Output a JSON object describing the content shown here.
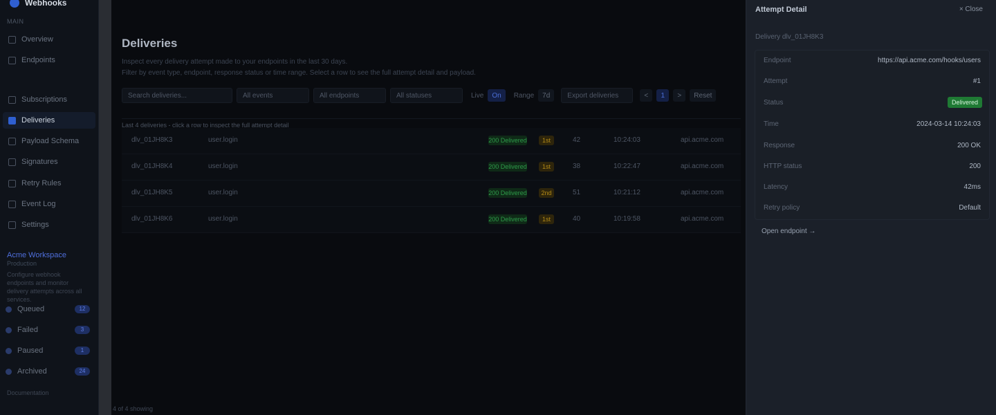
{
  "sidebar": {
    "brand": "Webhooks",
    "section_main": "Main",
    "nav": [
      "Overview",
      "Endpoints",
      "Subscriptions",
      "Deliveries",
      "Payload Schema",
      "Signatures",
      "Retry Rules",
      "Event Log",
      "Settings"
    ],
    "active_index": 3,
    "workspace_title": "Acme Workspace",
    "workspace_sub": "Production",
    "workspace_desc": "Configure webhook endpoints and monitor delivery attempts across all services.",
    "workspace_items": [
      {
        "label": "Queued",
        "count": "12"
      },
      {
        "label": "Failed",
        "count": "3"
      },
      {
        "label": "Paused",
        "count": "1"
      },
      {
        "label": "Archived",
        "count": "24"
      }
    ],
    "footer_label": "Documentation"
  },
  "main": {
    "title": "Deliveries",
    "desc_line1": "Inspect every delivery attempt made to your endpoints in the last 30 days.",
    "desc_line2": "Filter by event type, endpoint, response status or time range. Select a row to see the full attempt detail and payload.",
    "toolbar": {
      "search_placeholder": "Search deliveries...",
      "filter1": "All events",
      "filter2": "All endpoints",
      "filter3": "All statuses",
      "label_live": "Live",
      "btn_on": "On",
      "label_range": "Range",
      "btn_range": "7d",
      "export": "Export deliveries",
      "icon1": "<",
      "icon2": "1",
      "icon3": ">",
      "reset": "Reset"
    },
    "list_caption": "Last 4 deliveries - click a row to inspect the full attempt detail",
    "rows": [
      {
        "id": "dlv_01JH8K3",
        "event": "user.login",
        "status": "200 Delivered",
        "retry": "1st",
        "latency": "42",
        "endpoint": "api.acme.com",
        "time": "10:24:03"
      },
      {
        "id": "dlv_01JH8K4",
        "event": "user.login",
        "status": "200 Delivered",
        "retry": "1st",
        "latency": "38",
        "endpoint": "api.acme.com",
        "time": "10:22:47"
      },
      {
        "id": "dlv_01JH8K5",
        "event": "user.login",
        "status": "200 Delivered",
        "retry": "2nd",
        "latency": "51",
        "endpoint": "api.acme.com",
        "time": "10:21:12"
      },
      {
        "id": "dlv_01JH8K6",
        "event": "user.login",
        "status": "200 Delivered",
        "retry": "1st",
        "latency": "40",
        "endpoint": "api.acme.com",
        "time": "10:19:58"
      }
    ],
    "status_bar": "4 of 4 showing"
  },
  "drawer": {
    "title": "Attempt Detail",
    "close": "× Close",
    "sub": "Delivery dlv_01JH8K3",
    "fields": [
      {
        "key": "Endpoint",
        "value": "https://api.acme.com/hooks/users"
      },
      {
        "key": "Attempt",
        "value": "#1"
      },
      {
        "key": "Status",
        "value": "Delivered",
        "badge": true
      },
      {
        "key": "Time",
        "value": "2024-03-14 10:24:03"
      },
      {
        "key": "Response",
        "value": "200 OK"
      },
      {
        "key": "HTTP status",
        "value": "200"
      },
      {
        "key": "Latency",
        "value": "42ms"
      },
      {
        "key": "Retry policy",
        "value": "Default"
      }
    ],
    "link": "Open endpoint →"
  }
}
